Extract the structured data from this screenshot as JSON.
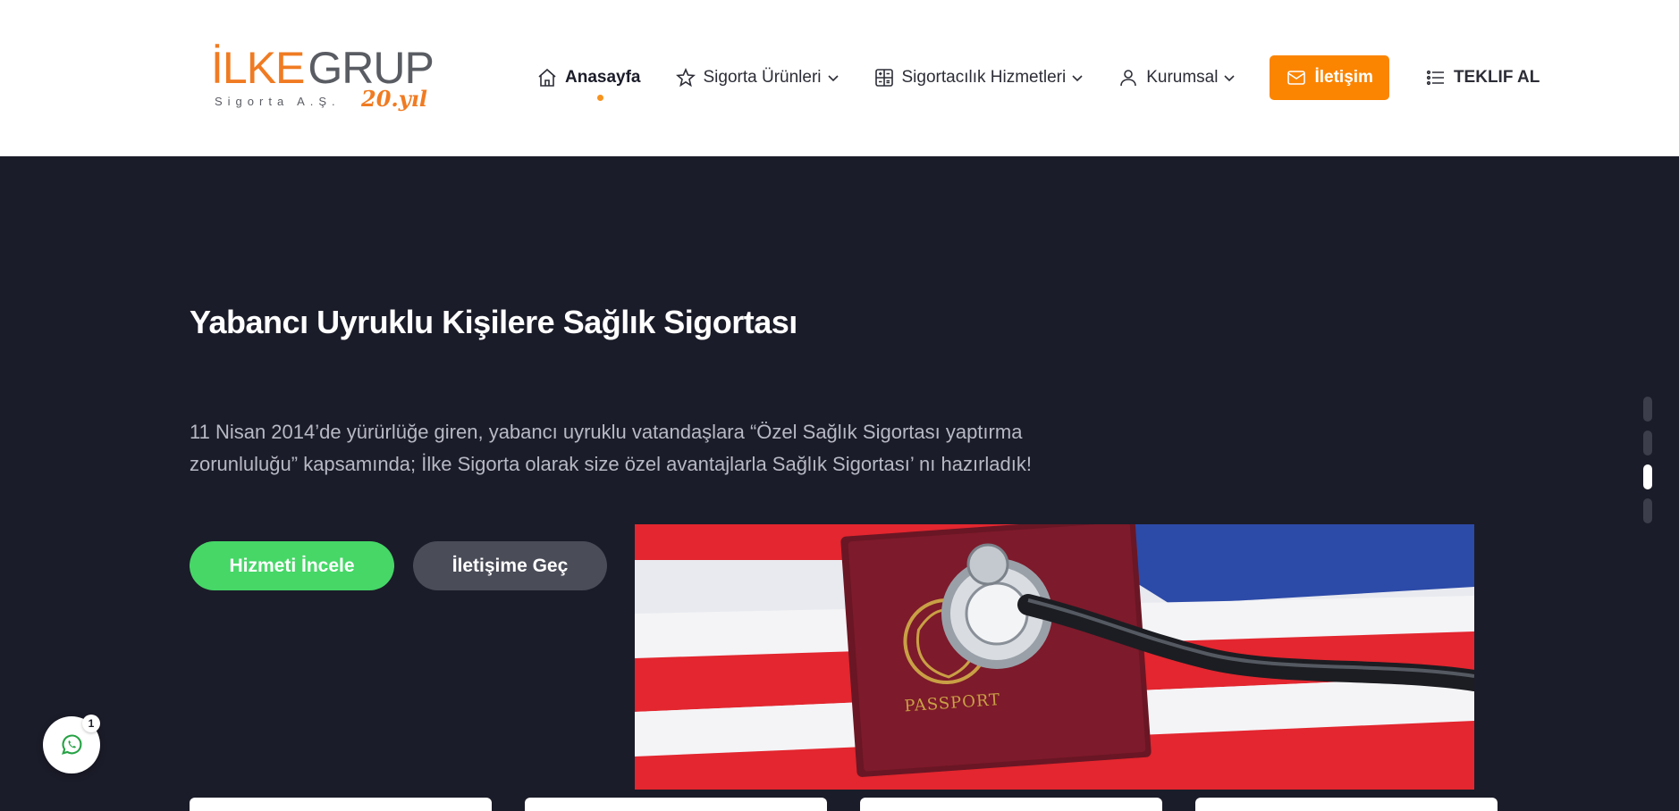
{
  "logo": {
    "ilke": "İLKE",
    "grup": "GRUP",
    "sub": "Sigorta A.Ş.",
    "year": "20.yıl"
  },
  "nav": {
    "items": [
      {
        "label": "Anasayfa",
        "icon": "home-icon",
        "active": true
      },
      {
        "label": "Sigorta Ürünleri",
        "icon": "star-icon",
        "has_dropdown": true
      },
      {
        "label": "Sigortacılık Hizmetleri",
        "icon": "calculator-icon",
        "has_dropdown": true
      },
      {
        "label": "Kurumsal",
        "icon": "user-icon",
        "has_dropdown": true
      }
    ],
    "contact_label": "İletişim",
    "quote_label": "TEKLIF AL"
  },
  "hero": {
    "title": "Yabancı Uyruklu Kişilere Sağlık Sigortası",
    "description": "11 Nisan 2014’de yürürlüğe giren, yabancı uyruklu vatandaşlara “Özel Sağlık Sigortası yaptırma zorunluluğu” kapsamında; İlke Sigorta olarak size özel avantajlarla Sağlık Sigortası’ nı hazırladık!",
    "primary_button": "Hizmeti İncele",
    "secondary_button": "İletişime Geç",
    "image_alt": "passport with stethoscope on flag",
    "image_text": "PASSPORT"
  },
  "slider": {
    "count": 4,
    "active_index": 2
  },
  "whatsapp": {
    "badge": "1"
  },
  "colors": {
    "accent": "#fb8500",
    "brand_orange": "#f07b22",
    "green": "#46d767",
    "dark_bg": "#1b1c29"
  }
}
